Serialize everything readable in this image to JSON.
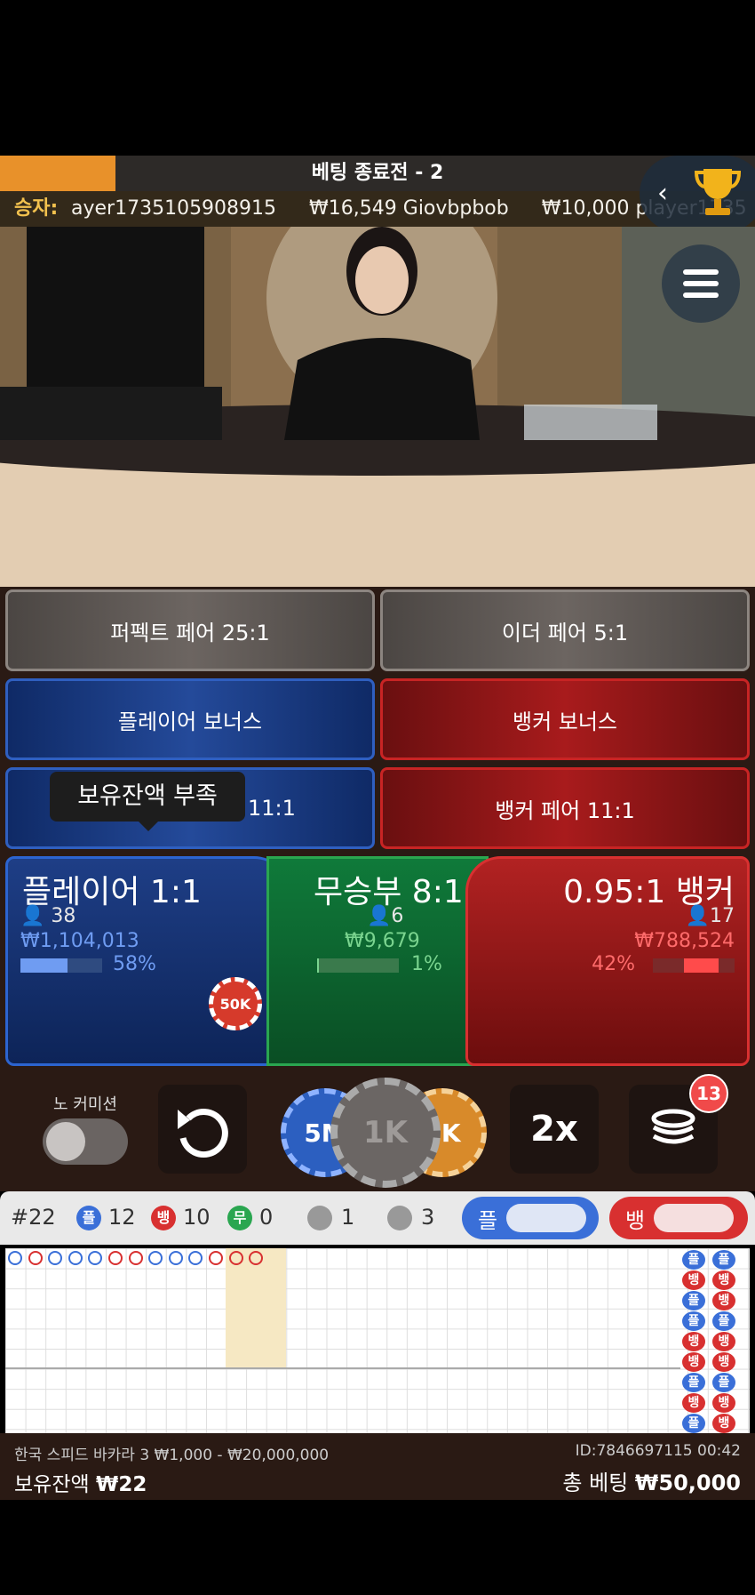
{
  "status": {
    "title": "베팅 종료전 - 2"
  },
  "ticker": {
    "label": "승자:",
    "entries": [
      "ayer1735105908915",
      "₩16,549 Giovbpbob",
      "₩10,000 player1735"
    ]
  },
  "bets": {
    "perfect_pair": "퍼펙트 페어 25:1",
    "either_pair": "이더 페어 5:1",
    "player_bonus": "플레이어 보너스",
    "banker_bonus": "뱅커 보너스",
    "player_pair_suffix": "11:1",
    "banker_pair": "뱅커 페어 11:1"
  },
  "tooltip": {
    "text": "보유잔액 부족"
  },
  "main": {
    "player": {
      "title": "플레이어 1:1",
      "count": "38",
      "amount": "₩1,104,013",
      "percent": "58%",
      "fraction": 0.58,
      "chip_label": "50K"
    },
    "tie": {
      "title": "무승부 8:1",
      "count": "6",
      "amount": "₩9,679",
      "percent": "1%",
      "fraction": 0.01
    },
    "banker": {
      "title": "0.95:1 뱅커",
      "count": "17",
      "amount": "₩788,524",
      "percent": "42%",
      "fraction": 0.42
    }
  },
  "controls": {
    "no_commission_label": "노 커미션",
    "chips": [
      "5M",
      "1K",
      "5K"
    ],
    "double_label": "2x",
    "stack_badge": "13"
  },
  "stats": {
    "round": "#22",
    "player_label": "플",
    "player_count": "12",
    "banker_label": "뱅",
    "banker_count": "10",
    "tie_label": "무",
    "tie_count": "0",
    "player_pair_count": "1",
    "banker_pair_count": "3",
    "predict_player": "플",
    "predict_banker": "뱅"
  },
  "bead_labels": [
    "플",
    "플",
    "뱅",
    "뱅",
    "플",
    "뱅",
    "플",
    "플",
    "뱅",
    "뱅",
    "뱅",
    "뱅",
    "플",
    "플",
    "뱅",
    "뱅",
    "플",
    "뱅"
  ],
  "footer": {
    "table_name": "한국 스피드 바카라 3 ₩1,000 - ₩20,000,000",
    "id_time": "ID:7846697115 00:42",
    "balance_label": "보유잔액",
    "balance_value": "₩22",
    "total_label": "총 베팅",
    "total_value": "₩50,000"
  },
  "colors": {
    "player": "#2c64d0",
    "banker": "#d83030",
    "tie": "#2aa650",
    "accent": "#e8912a"
  }
}
